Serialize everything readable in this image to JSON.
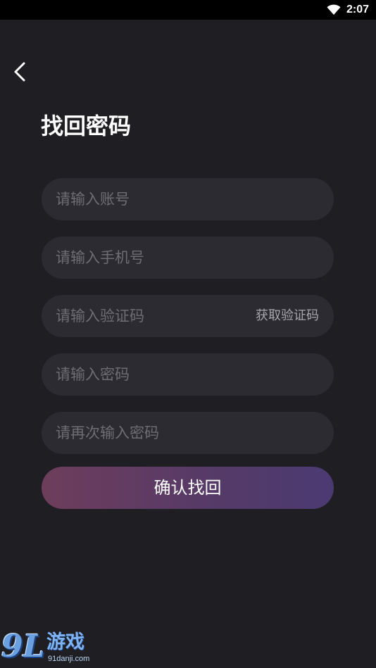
{
  "status_bar": {
    "time": "2:07",
    "wifi_icon": "wifi-icon"
  },
  "header": {
    "back_icon": "chevron-left-icon",
    "title": "找回密码"
  },
  "form": {
    "account_placeholder": "请输入账号",
    "phone_placeholder": "请输入手机号",
    "code_placeholder": "请输入验证码",
    "get_code_label": "获取验证码",
    "password_placeholder": "请输入密码",
    "confirm_password_placeholder": "请再次输入密码",
    "submit_label": "确认找回"
  },
  "watermark": {
    "logo_text": "9L",
    "name": "游戏",
    "url": "91danji.com"
  },
  "colors": {
    "background": "#1f1e23",
    "field_background": "#2c2b31",
    "placeholder": "#6e6d73",
    "button_gradient_start": "#6e3d5c",
    "button_gradient_end": "#4b3a72"
  }
}
